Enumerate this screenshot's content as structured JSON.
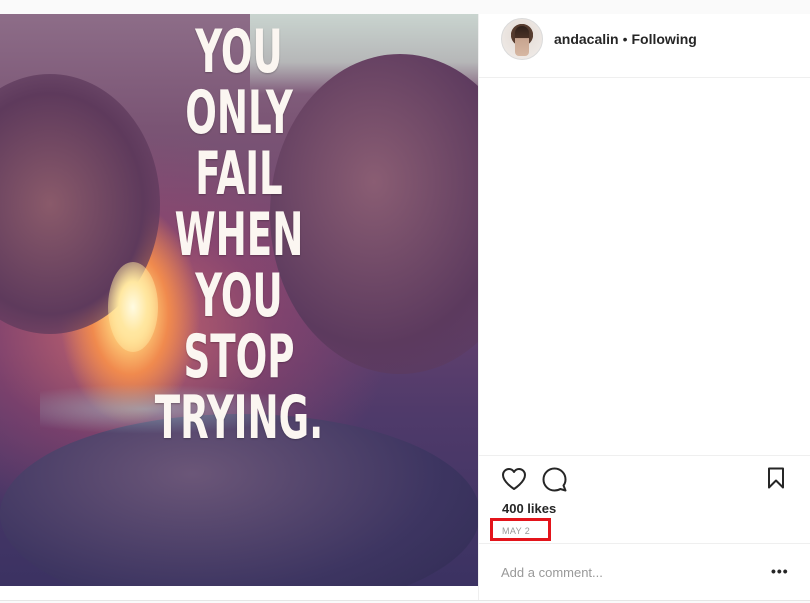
{
  "post": {
    "image": {
      "quote_lines": [
        "YOU",
        "ONLY",
        "FAIL",
        "WHEN",
        "YOU",
        "STOP",
        "TRYING."
      ]
    },
    "header": {
      "username": "andacalin",
      "separator": "•",
      "follow_status": "Following"
    },
    "likes": "400 likes",
    "date": "MAY 2",
    "comment": {
      "placeholder": "Add a comment...",
      "value": ""
    },
    "more_label": "•••"
  },
  "colors": {
    "accent_highlight": "#e3141b",
    "text_primary": "#262626",
    "text_secondary": "#999999"
  },
  "icons": [
    "heart-icon",
    "comment-icon",
    "bookmark-icon",
    "more-options-icon"
  ]
}
